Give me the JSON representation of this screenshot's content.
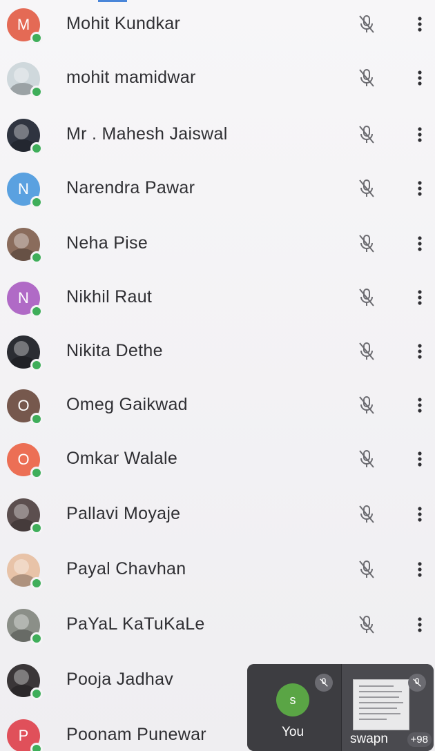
{
  "participants": [
    {
      "name": "Mohit Kundkar",
      "initial": "M",
      "avatar_color": "#e46a55",
      "photo": false
    },
    {
      "name": "mohit mamidwar",
      "initial": "",
      "avatar_color": "#cfd8dc",
      "photo": true
    },
    {
      "name": "Mr . Mahesh Jaiswal",
      "initial": "",
      "avatar_color": "#2f3440",
      "photo": true
    },
    {
      "name": "Narendra Pawar",
      "initial": "N",
      "avatar_color": "#5aa1e0",
      "photo": false
    },
    {
      "name": "Neha Pise",
      "initial": "",
      "avatar_color": "#8a6c5c",
      "photo": true
    },
    {
      "name": "Nikhil Raut",
      "initial": "N",
      "avatar_color": "#b06ac6",
      "photo": false
    },
    {
      "name": "Nikita Dethe",
      "initial": "",
      "avatar_color": "#2b2d33",
      "photo": true
    },
    {
      "name": "Omeg Gaikwad",
      "initial": "O",
      "avatar_color": "#76584d",
      "photo": false
    },
    {
      "name": "Omkar Walale",
      "initial": "O",
      "avatar_color": "#ec6f55",
      "photo": false
    },
    {
      "name": "Pallavi Moyaje",
      "initial": "",
      "avatar_color": "#5c4f4f",
      "photo": true
    },
    {
      "name": "Payal Chavhan",
      "initial": "",
      "avatar_color": "#e8c3a8",
      "photo": true
    },
    {
      "name": "PaYaL KaTuKaLe",
      "initial": "",
      "avatar_color": "#8b8f88",
      "photo": true
    },
    {
      "name": "Pooja Jadhav",
      "initial": "",
      "avatar_color": "#3a3638",
      "photo": true
    },
    {
      "name": "Poonam Punewar",
      "initial": "P",
      "avatar_color": "#e0505a",
      "photo": false
    }
  ],
  "icons": {
    "mic": "mic-off-icon",
    "more": "more-vert-icon",
    "presence": "online-dot-icon"
  },
  "self_view": {
    "self_initial": "s",
    "self_label": "You",
    "other_label": "swapn",
    "overflow_count": "+98"
  },
  "colors": {
    "presence": "#3fae5a",
    "accent": "#4a86d9",
    "self_avatar": "#5aa545"
  }
}
